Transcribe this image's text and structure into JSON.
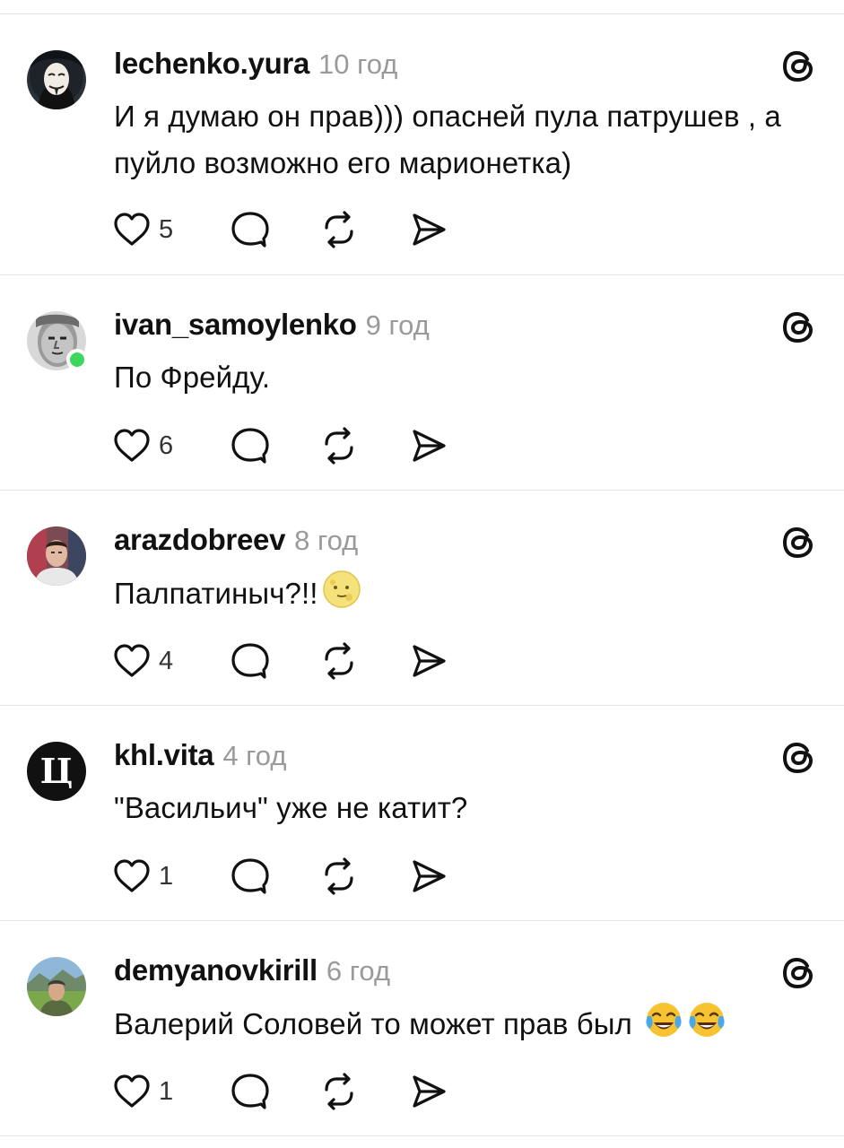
{
  "posts": [
    {
      "username": "lechenko.yura",
      "time": "10 год",
      "text": "И я думаю он прав))) опасней пула патрушев , а пуйло возможно его марионетка)",
      "likes": "5",
      "emoji": []
    },
    {
      "username": "ivan_samoylenko",
      "time": "9 год",
      "text": "По Фрейду.",
      "likes": "6",
      "online": true,
      "emoji": []
    },
    {
      "username": "arazdobreev",
      "time": "8 год",
      "text": "Палпатиныч?!!",
      "likes": "4",
      "emoji": [
        "moon-face-emoji"
      ]
    },
    {
      "username": "khl.vita",
      "time": "4 год",
      "text": "\"Васильич\" уже не катит?",
      "likes": "1",
      "avatar_letter": "Ц",
      "emoji": []
    },
    {
      "username": "demyanovkirill",
      "time": "6 год",
      "text": "Валерий Соловей то может прав был",
      "likes": "1",
      "emoji": [
        "tears-of-joy-emoji",
        "tears-of-joy-emoji"
      ]
    }
  ],
  "icons": {
    "like": "heart-icon",
    "reply": "reply-bubble-icon",
    "repost": "repost-icon",
    "share": "send-icon",
    "app": "threads-logo-icon"
  },
  "colors": {
    "online": "#3dd75e",
    "timestamp": "#9a9a9a",
    "divider": "#e3e3e3"
  }
}
